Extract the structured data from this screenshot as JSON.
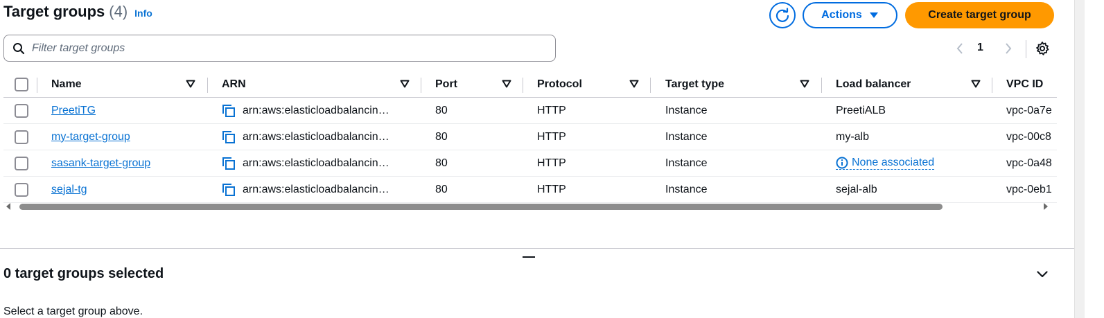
{
  "header": {
    "title": "Target groups",
    "count": "(4)",
    "info": "Info"
  },
  "toolbar": {
    "actions_label": "Actions",
    "create_label": "Create target group"
  },
  "filter": {
    "placeholder": "Filter target groups",
    "value": ""
  },
  "pagination": {
    "current_page": "1"
  },
  "table": {
    "columns": [
      "Name",
      "ARN",
      "Port",
      "Protocol",
      "Target type",
      "Load balancer",
      "VPC ID"
    ],
    "rows": [
      {
        "name": "PreetiTG",
        "arn": "arn:aws:elasticloadbalancin…",
        "port": "80",
        "protocol": "HTTP",
        "target_type": "Instance",
        "load_balancer": "PreetiALB",
        "vpc_id": "vpc-0a7e"
      },
      {
        "name": "my-target-group",
        "arn": "arn:aws:elasticloadbalancin…",
        "port": "80",
        "protocol": "HTTP",
        "target_type": "Instance",
        "load_balancer": "my-alb",
        "vpc_id": "vpc-00c8"
      },
      {
        "name": "sasank-target-group",
        "arn": "arn:aws:elasticloadbalancin…",
        "port": "80",
        "protocol": "HTTP",
        "target_type": "Instance",
        "load_balancer": "None associated",
        "vpc_id": "vpc-0a48"
      },
      {
        "name": "sejal-tg",
        "arn": "arn:aws:elasticloadbalancin…",
        "port": "80",
        "protocol": "HTTP",
        "target_type": "Instance",
        "load_balancer": "sejal-alb",
        "vpc_id": "vpc-0eb1"
      }
    ]
  },
  "selection_panel": {
    "title": "0 target groups selected",
    "message": "Select a target group above."
  },
  "icons": {
    "refresh": "refresh-icon",
    "caret": "caret-down-icon",
    "search": "search-icon",
    "prev": "chevron-left-icon",
    "next": "chevron-right-icon",
    "settings": "gear-icon",
    "copy": "copy-icon",
    "info": "info-icon",
    "collapse": "chevron-down-icon"
  },
  "colors": {
    "primary_blue": "#006ce0",
    "link_blue": "#0972d3",
    "orange": "#ff9900",
    "text": "#0f141a"
  }
}
